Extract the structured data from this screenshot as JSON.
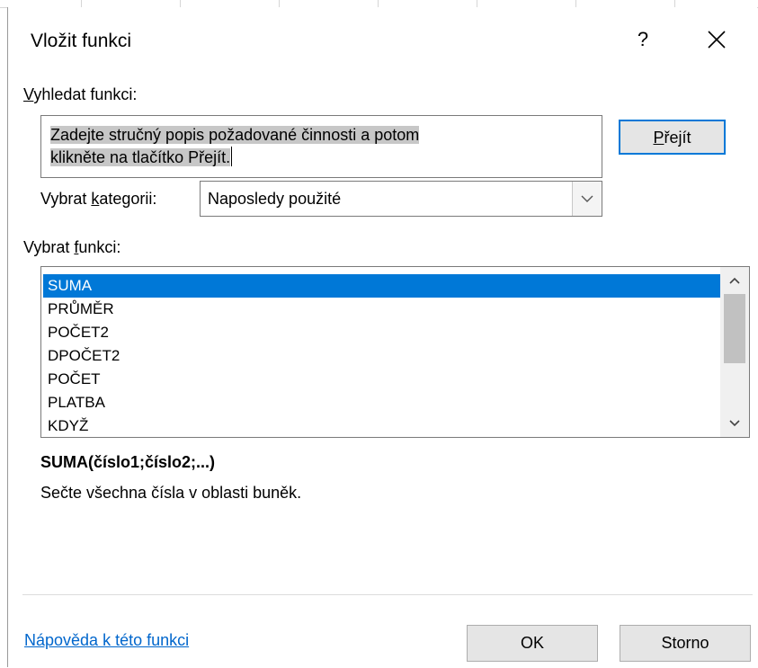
{
  "dialog": {
    "title": "Vložit funkci",
    "help_label": "?",
    "close_icon": "close-icon"
  },
  "search": {
    "label_prefix": "",
    "label_accel": "V",
    "label_rest": "yhledat funkci:",
    "text_line1": "Zadejte stručný popis požadované činnosti a potom",
    "text_line2": "klikněte na tlačítko Přejít.",
    "go_prefix": "",
    "go_accel": "P",
    "go_rest": "řejít"
  },
  "category": {
    "label_prefix": "Vybrat ",
    "label_accel": "k",
    "label_rest": "ategorii:",
    "selected": "Naposledy použité"
  },
  "functions": {
    "label_prefix": "Vybrat ",
    "label_accel": "f",
    "label_rest": "unkci:",
    "items": [
      "SUMA",
      "PRŮMĚR",
      "POČET2",
      "DPOČET2",
      "POČET",
      "PLATBA",
      "KDYŽ"
    ],
    "selected_index": 0
  },
  "details": {
    "syntax": "SUMA(číslo1;číslo2;...)",
    "description": "Sečte všechna čísla v oblasti buněk."
  },
  "footer": {
    "help_link": "Nápověda k této funkci",
    "ok": "OK",
    "cancel": "Storno"
  },
  "colors": {
    "accent": "#0078d7",
    "link": "#0066cc",
    "selection_gray": "#c7c7c7"
  }
}
